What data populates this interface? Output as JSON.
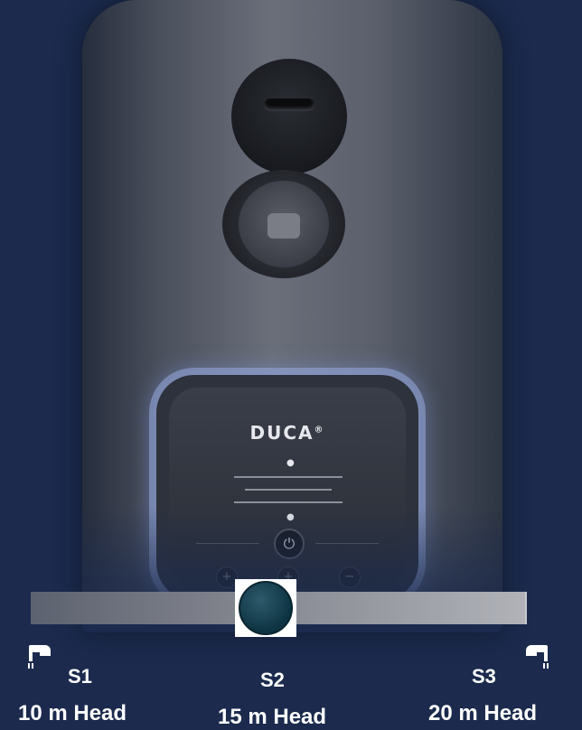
{
  "product": {
    "brand": "DUCA",
    "registered_mark": "®",
    "power_symbol": "⏻",
    "btn_plus": "+",
    "btn_mid": "+",
    "btn_minus": "−",
    "drop_icon": "drop-icon"
  },
  "slider": {
    "selected": "S2",
    "value_fraction": 0.5,
    "accent_color": "#0d3342",
    "track_colors": [
      "#5d6270",
      "#b0b2b8"
    ]
  },
  "settings": [
    {
      "id": "S1",
      "head": "10 m Head",
      "icon": "faucet-left-icon"
    },
    {
      "id": "S2",
      "head": "15 m Head",
      "icon": ""
    },
    {
      "id": "S3",
      "head": "20 m Head",
      "icon": "faucet-right-icon"
    }
  ],
  "colors": {
    "background": "#1b2a4d",
    "text": "#ffffff"
  }
}
